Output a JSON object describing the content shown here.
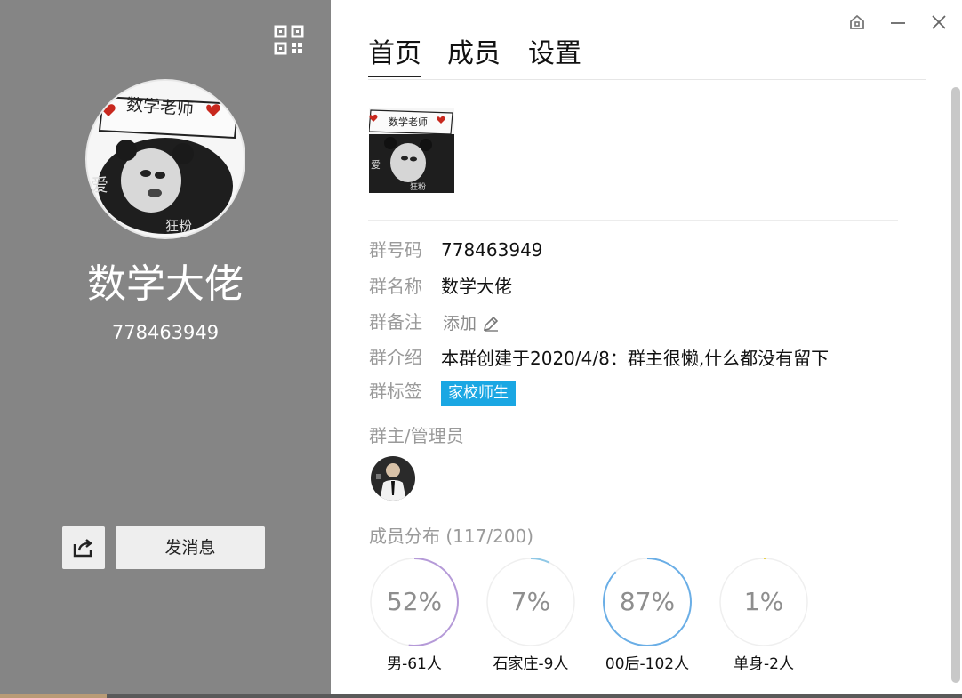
{
  "left_panel": {
    "avatar_banner_text": "数学老师",
    "group_name": "数学大佬",
    "group_id": "778463949",
    "send_message_label": "发消息"
  },
  "tabs": [
    {
      "label": "首页",
      "active": true
    },
    {
      "label": "成员",
      "active": false
    },
    {
      "label": "设置",
      "active": false
    }
  ],
  "info": {
    "number_label": "群号码",
    "number_value": "778463949",
    "name_label": "群名称",
    "name_value": "数学大佬",
    "remark_label": "群备注",
    "remark_add_label": "添加",
    "intro_label": "群介绍",
    "intro_value": "本群创建于2020/4/8：群主很懒,什么都没有留下",
    "tags_label": "群标签",
    "tag_value": "家校师生"
  },
  "admins": {
    "title": "群主/管理员"
  },
  "distribution": {
    "title": "成员分布 (117/200)",
    "items": [
      {
        "percent_label": "52%",
        "fraction": 0.52,
        "color": "#b59ad8",
        "caption": "男-61人"
      },
      {
        "percent_label": "7%",
        "fraction": 0.07,
        "color": "#8fc8e6",
        "caption": "石家庄-9人"
      },
      {
        "percent_label": "87%",
        "fraction": 0.87,
        "color": "#6aaee6",
        "caption": "00后-102人"
      },
      {
        "percent_label": "1%",
        "fraction": 0.01,
        "color": "#e8d24c",
        "caption": "单身-2人"
      }
    ]
  },
  "colors": {
    "left_panel_bg": "#858585",
    "tag_bg": "#1aa7e3"
  },
  "icons": [
    "qr-code-icon",
    "share-icon",
    "home-icon",
    "minimize-icon",
    "close-icon",
    "edit-pencil-icon"
  ]
}
